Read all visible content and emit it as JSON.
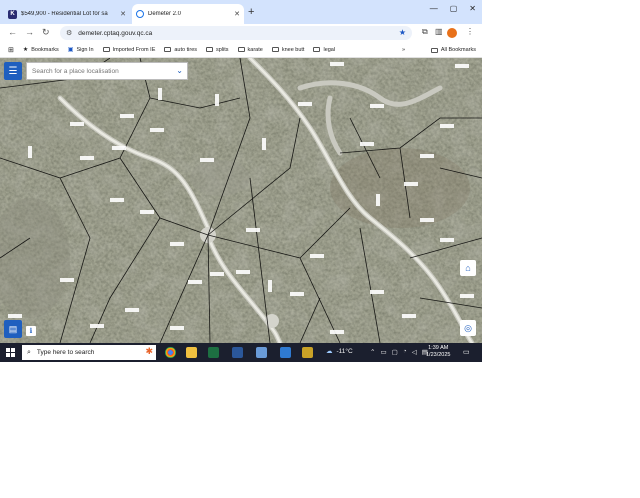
{
  "browser": {
    "tabs": [
      {
        "label": "$549,900 - Residential Lot for sa",
        "icon": "kijiji-k-icon"
      },
      {
        "label": "Demeter 2.0",
        "icon": "demeter-pin-icon",
        "active": true
      }
    ],
    "new_tab": "+",
    "window_controls": {
      "minimize": "—",
      "maximize": "▢",
      "close": "✕"
    },
    "url": "demeter.cptaq.gouv.qc.ca",
    "profile_initial": "",
    "bookmarks": [
      {
        "label": "Bookmarks",
        "icon": "star-icon"
      },
      {
        "label": "Sign In",
        "icon": "sign-in-icon"
      },
      {
        "label": "Imported From IE",
        "icon": "folder-icon"
      },
      {
        "label": "auto tires",
        "icon": "folder-icon"
      },
      {
        "label": "splits",
        "icon": "folder-icon"
      },
      {
        "label": "karate",
        "icon": "folder-icon"
      },
      {
        "label": "knee butt",
        "icon": "folder-icon"
      },
      {
        "label": "legal",
        "icon": "folder-icon"
      }
    ],
    "all_bookmarks": "All Bookmarks"
  },
  "map": {
    "search_placeholder": "Search for a place localisation",
    "menu_icon": "hamburger-menu-icon",
    "home_icon": "home-icon",
    "locate_icon": "locate-icon",
    "layers_icon": "layers-icon",
    "info_icon": "info-icon"
  },
  "taskbar": {
    "search_text": "Type here to search",
    "weather": "-11°C",
    "time": "1:39 AM",
    "date": "1/23/2025"
  }
}
